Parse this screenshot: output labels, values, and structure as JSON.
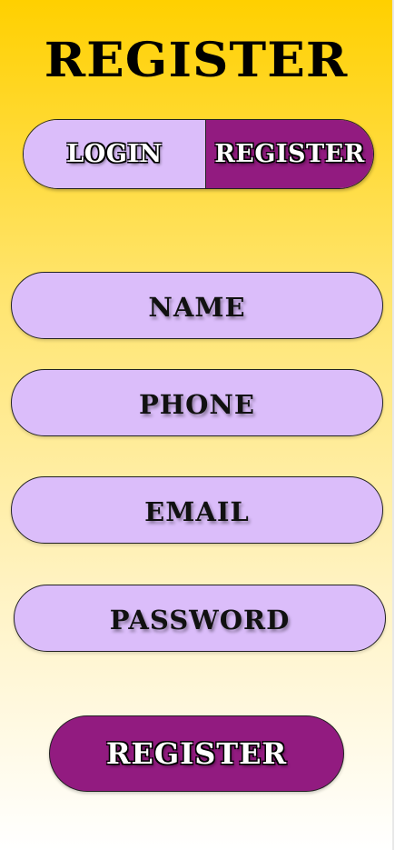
{
  "page": {
    "title": "REGISTER"
  },
  "tabs": {
    "login_label": "LOGIN",
    "register_label": "REGISTER",
    "active": "register"
  },
  "form": {
    "fields": [
      {
        "placeholder": "NAME"
      },
      {
        "placeholder": "PHONE"
      },
      {
        "placeholder": "EMAIL"
      },
      {
        "placeholder": "PASSWORD"
      }
    ],
    "submit_label": "REGISTER"
  },
  "colors": {
    "background_top": "#ffd000",
    "background_bottom": "#ffffff",
    "field_fill": "#dbbdfa",
    "accent": "#921b80"
  }
}
